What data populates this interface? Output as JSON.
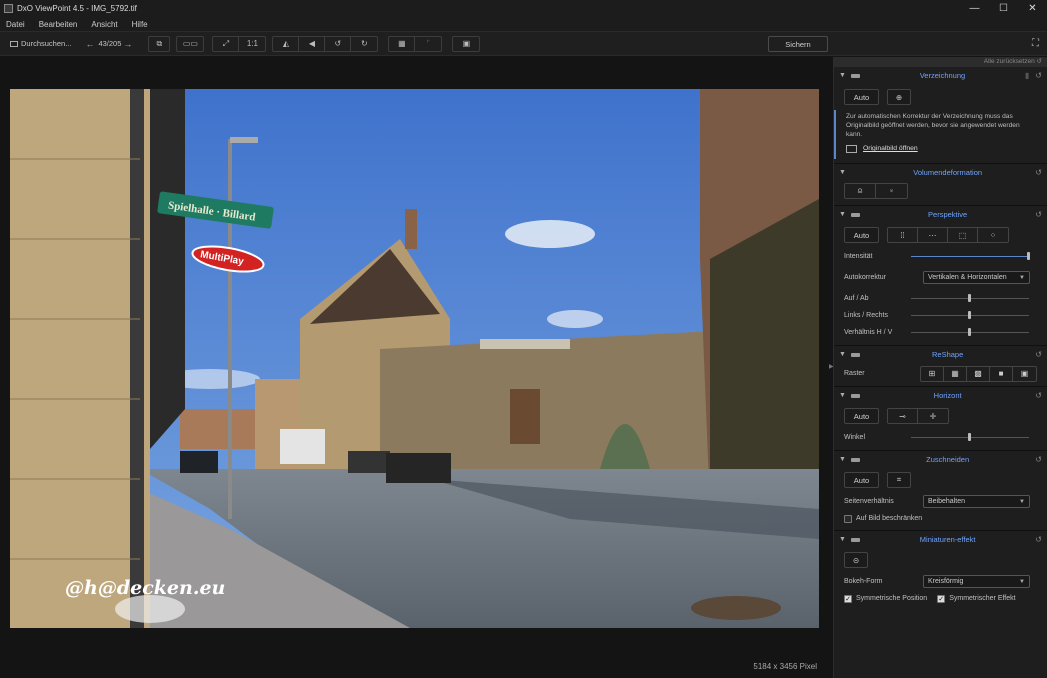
{
  "window": {
    "title": "DxO ViewPoint 4.5 - IMG_5792.tif",
    "controls": [
      "—",
      "☐",
      "✕"
    ]
  },
  "menu": [
    "Datei",
    "Bearbeiten",
    "Ansicht",
    "Hilfe"
  ],
  "toolbar": {
    "browse_label": "Durchsuchen...",
    "counter": "43/205",
    "zoom_label": "1:1",
    "save_label": "Sichern"
  },
  "viewer": {
    "pixel_info": "5184 x 3456 Pixel",
    "watermark": "@h@decken.eu",
    "signs": {
      "billard": "Spielhalle · Billard",
      "multiplay": "MultiPlay"
    }
  },
  "panel": {
    "reset_all": "Alle zurücksetzen",
    "distortion": {
      "title": "Verzeichnung",
      "auto": "Auto",
      "notice": "Zur automatischen Korrektur der Verzeichnung muss das Originalbild geöffnet werden, bevor sie angewendet werden kann.",
      "open_link": "Originalbild öffnen"
    },
    "volume": {
      "title": "Volumendeformation"
    },
    "perspective": {
      "title": "Perspektive",
      "auto": "Auto",
      "intensity_label": "Intensität",
      "intensity_level": 1.0,
      "autocorr_label": "Autokorrektur",
      "autocorr_value": "Vertikalen & Horizontalen",
      "up_down_label": "Auf / Ab",
      "up_down_level": 0.5,
      "left_right_label": "Links / Rechts",
      "left_right_level": 0.5,
      "ratio_label": "Verhältnis H / V",
      "ratio_level": 0.5
    },
    "reshape": {
      "title": "ReShape",
      "grid_label": "Raster"
    },
    "horizon": {
      "title": "Horizont",
      "auto": "Auto",
      "angle_label": "Winkel",
      "angle_level": 0.5
    },
    "crop": {
      "title": "Zuschneiden",
      "auto": "Auto",
      "ratio_label": "Seitenverhältnis",
      "ratio_value": "Beibehalten",
      "restrict_label": "Auf Bild beschränken"
    },
    "miniature": {
      "title": "Miniaturen-effekt",
      "bokeh_label": "Bokeh-Form",
      "bokeh_value": "Kreisförmig",
      "sym_pos_label": "Symmetrische Position",
      "sym_effect_label": "Symmetrischer Effekt"
    }
  },
  "colors": {
    "accent": "#6ea3ff",
    "panel_bg": "#1e1e1e",
    "sky": "#4a7bd0"
  }
}
